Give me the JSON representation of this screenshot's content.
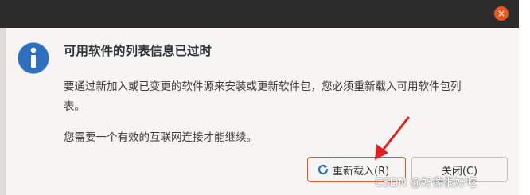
{
  "window": {
    "close_glyph": "×"
  },
  "dialog": {
    "heading": "可用软件的列表信息已过时",
    "message_line1": "要通过新加入或已变更的软件源来安装或更新软件包，您必须重新载入可用软件包列",
    "message_line2": "表。",
    "message_line3": "您需要一个有效的互联网连接才能继续。",
    "icon": "info-icon"
  },
  "buttons": {
    "reload_label": "重新载入(R)",
    "reload_icon": "reload-icon",
    "close_label": "关闭(C)"
  },
  "colors": {
    "accent": "#e95420",
    "titlebar": "#2c2c2c",
    "info_icon": "#2f6fc0",
    "annotation_arrow": "#e62020"
  },
  "watermark": "CSDN @好像很好吃"
}
